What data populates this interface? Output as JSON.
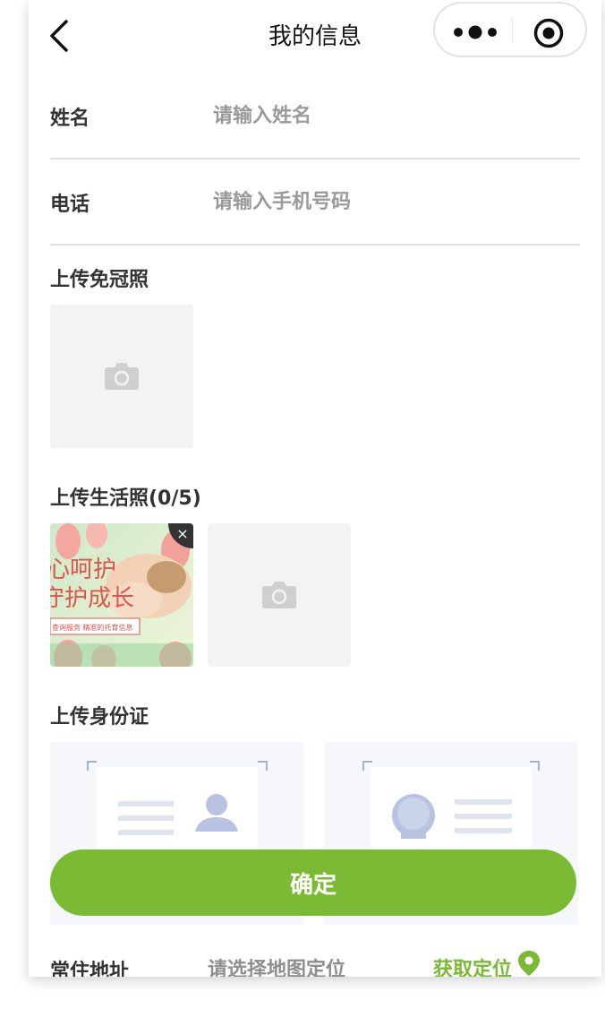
{
  "nav": {
    "title": "我的信息",
    "back_icon": "chevron-left-icon",
    "more_icon": "more-dots-icon",
    "record_icon": "target-icon"
  },
  "form": {
    "name": {
      "label": "姓名",
      "placeholder": "请输入姓名",
      "value": ""
    },
    "phone": {
      "label": "电话",
      "placeholder": "请输入手机号码",
      "value": ""
    }
  },
  "uploads": {
    "hatless": {
      "title": "上传免冠照"
    },
    "life": {
      "title": "上传生活照(0/5)",
      "photo_text": {
        "line1": "心呵护",
        "line2": "守护成长",
        "banner": "查询服务 精准的托育信息"
      },
      "remove_label": "×"
    },
    "idcard": {
      "title": "上传身份证"
    }
  },
  "confirm_label": "确定",
  "address": {
    "label": "常住地址",
    "placeholder": "请选择地图定位",
    "locate_label": "获取定位"
  },
  "colors": {
    "accent": "#7bba33"
  }
}
